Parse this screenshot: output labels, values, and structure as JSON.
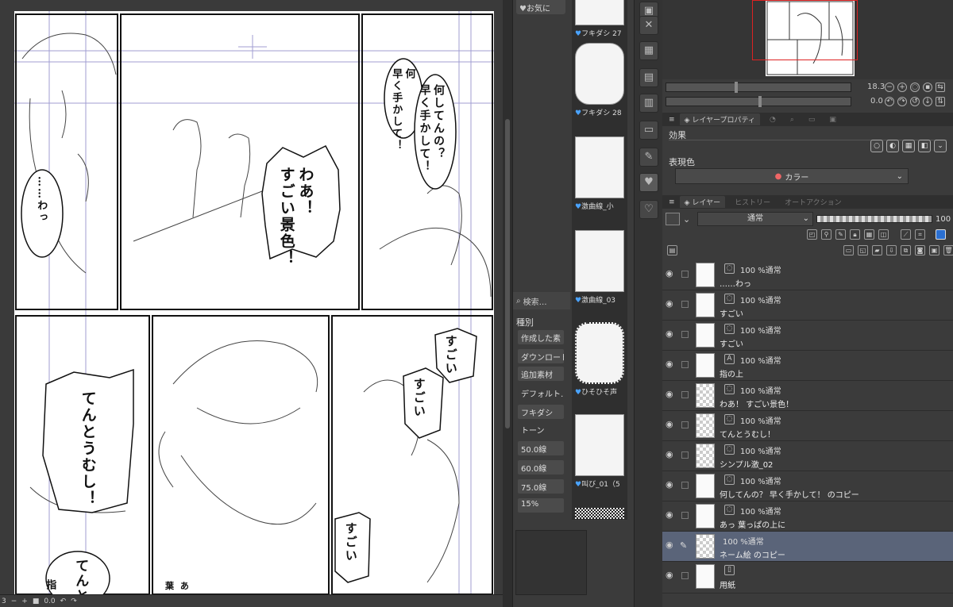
{
  "canvas": {
    "balloons": {
      "waa": "わあ！\nすごい景色！",
      "nanishiten": "何してんの？\n早く手かして！",
      "nanishiten_partial": "何\n早く手かして！",
      "dots_wa": "……わっ",
      "tentoumushi": "てんとうむし！",
      "sugoi1": "すごい",
      "sugoi2": "すごい",
      "sugoi3": "すごい",
      "tento_partial": "てんと",
      "yubi_partial": "指",
      "ha_partial": "葉 あ"
    },
    "status": {
      "zoom_left": "3",
      "zoom_right": "0.0",
      "minus": "−",
      "plus": "+"
    }
  },
  "materials": {
    "tab": "お気に",
    "search": "検索…",
    "category_label": "種別",
    "categories": [
      "作成した素",
      "ダウンロード",
      "追加素材",
      "デフォルト…",
      "フキダシ",
      "トーン",
      "50.0線",
      "60.0線",
      "75.0線",
      "15%"
    ],
    "items": [
      {
        "name": "フキダシ 27"
      },
      {
        "name": "フキダシ 28"
      },
      {
        "name": "激曲線_小"
      },
      {
        "name": "激曲線_03"
      },
      {
        "name": "ひそひそ声"
      },
      {
        "name": "叫び_01（5"
      }
    ]
  },
  "navigator": {
    "zoom": "18.3",
    "rotate": "0.0"
  },
  "layer_property": {
    "tabs": [
      "レイヤープロパティ"
    ],
    "effect_label": "効果",
    "color_label": "表現色",
    "color_value": "カラー"
  },
  "layer_panel": {
    "tabs": [
      "レイヤー",
      "ヒストリー",
      "オートアクション"
    ],
    "blend_mode": "通常",
    "opacity": "100",
    "layers": [
      {
        "mode": "100 %通常",
        "name": "……わっ",
        "kind": "balloon"
      },
      {
        "mode": "100 %通常",
        "name": "すごい",
        "kind": "balloon"
      },
      {
        "mode": "100 %通常",
        "name": "すごい",
        "kind": "balloon"
      },
      {
        "mode": "100 %通常",
        "name": "指の上",
        "kind": "text"
      },
      {
        "mode": "100 %通常",
        "name": "わあ！ すごい景色！",
        "kind": "balloon"
      },
      {
        "mode": "100 %通常",
        "name": "てんとうむし！",
        "kind": "balloon"
      },
      {
        "mode": "100 %通常",
        "name": "シンプル激_02",
        "kind": "balloon"
      },
      {
        "mode": "100 %通常",
        "name": "何してんの？ 早く手かして！ のコピー",
        "kind": "balloon"
      },
      {
        "mode": "100 %通常",
        "name": "あっ 葉っぱの上に",
        "kind": "balloon"
      },
      {
        "mode": "100 %通常",
        "name": "ネーム絵 のコピー",
        "kind": "raster"
      },
      {
        "mode": "",
        "name": "用紙",
        "kind": "paper"
      }
    ]
  },
  "colors": {
    "accent_blue": "#4aa3ff",
    "active_layer": "#5a6479",
    "nav_frame": "#dd2222"
  }
}
